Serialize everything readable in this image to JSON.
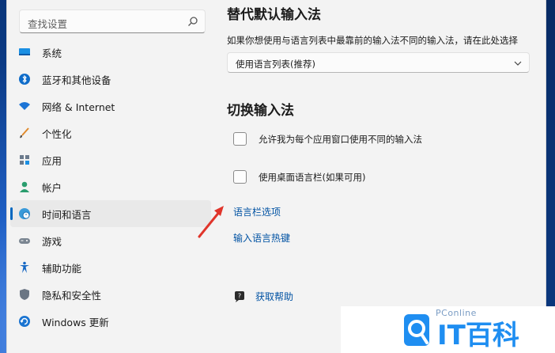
{
  "search": {
    "placeholder": "查找设置"
  },
  "sidebar": {
    "items": [
      {
        "label": "系统",
        "icon": "system-icon"
      },
      {
        "label": "蓝牙和其他设备",
        "icon": "bluetooth-icon"
      },
      {
        "label": "网络 & Internet",
        "icon": "wifi-icon"
      },
      {
        "label": "个性化",
        "icon": "brush-icon"
      },
      {
        "label": "应用",
        "icon": "apps-icon"
      },
      {
        "label": "帐户",
        "icon": "account-icon"
      },
      {
        "label": "时间和语言",
        "icon": "globe-clock-icon",
        "active": true
      },
      {
        "label": "游戏",
        "icon": "gamepad-icon"
      },
      {
        "label": "辅助功能",
        "icon": "accessibility-icon"
      },
      {
        "label": "隐私和安全性",
        "icon": "shield-icon"
      },
      {
        "label": "Windows 更新",
        "icon": "update-icon"
      }
    ]
  },
  "main": {
    "section1_title": "替代默认输入法",
    "section1_desc": "如果你想使用与语言列表中最靠前的输入法不同的输入法，请在此处选择",
    "select_value": "使用语言列表(推荐)",
    "section2_title": "切换输入法",
    "checkbox1_label": "允许我为每个应用窗口使用不同的输入法",
    "checkbox2_label": "使用桌面语言栏(如果可用)",
    "link1": "语言栏选项",
    "link2": "输入语言热键",
    "help_label": "获取帮助"
  },
  "watermark": {
    "brand": "PConline",
    "logo_text": "IT百科"
  },
  "colors": {
    "accent": "#0067c0",
    "link": "#0052a3",
    "arrow": "#e0352b"
  }
}
